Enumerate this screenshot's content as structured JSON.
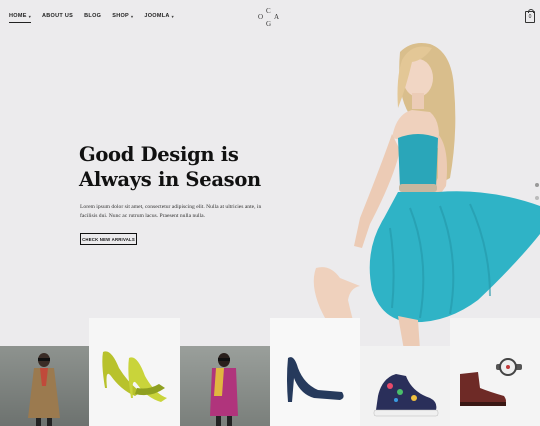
{
  "nav": {
    "items": [
      {
        "label": "HOME",
        "caret": "▾"
      },
      {
        "label": "ABOUT US",
        "caret": ""
      },
      {
        "label": "BLOG",
        "caret": ""
      },
      {
        "label": "SHOP",
        "caret": "▾"
      },
      {
        "label": "JOOMLA",
        "caret": "▾"
      }
    ]
  },
  "logo": {
    "letters": [
      "O",
      "C",
      "A",
      "G"
    ]
  },
  "cart": {
    "count": "0",
    "icon": "shopping-bag-icon"
  },
  "hero": {
    "title_line1": "Good Design is",
    "title_line2": "Always in Season",
    "subtitle": "Lorem ipsum dolor sit amet, consectetur adipiscing elit. Nulla at ultricies ante, in facilisis dui. Nunc ac rutrum lacus. Praesent nulla nulla.",
    "cta": "CHECK NEW ARRIVALS"
  },
  "colors": {
    "background": "#ecebed",
    "dress": "#2fb3c6",
    "text": "#111111"
  }
}
